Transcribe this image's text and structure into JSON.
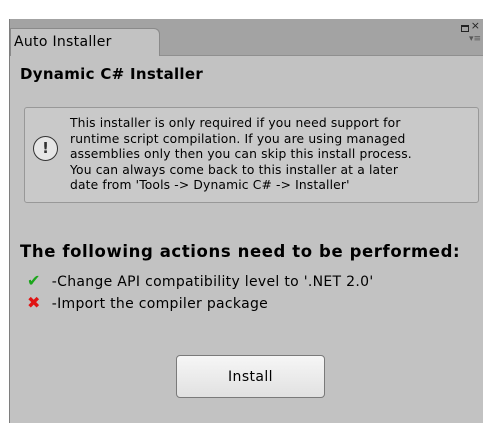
{
  "window": {
    "tab_title": "Auto Installer",
    "close_glyph": "×",
    "menu_glyph": "▾≡"
  },
  "heading": "Dynamic C# Installer",
  "help_box": {
    "icon": "info-icon",
    "text": "This installer is only required if you need support for\nruntime script compilation. If you are using managed\nassemblies only then you can skip this install process.\nYou can always come back to this installer at a later\ndate from 'Tools -> Dynamic C# -> Installer'"
  },
  "actions": {
    "heading": "The following actions need to be performed:",
    "items": [
      {
        "icon": "check-icon",
        "glyph": "✔",
        "label": "-Change API compatibility level to '.NET 2.0'"
      },
      {
        "icon": "cross-icon",
        "glyph": "✖",
        "label": "-Import the compiler package"
      }
    ]
  },
  "install_button": {
    "label": "Install"
  },
  "colors": {
    "check": "#1ba61b",
    "cross": "#e01414",
    "panel": "#c2c2c2"
  }
}
